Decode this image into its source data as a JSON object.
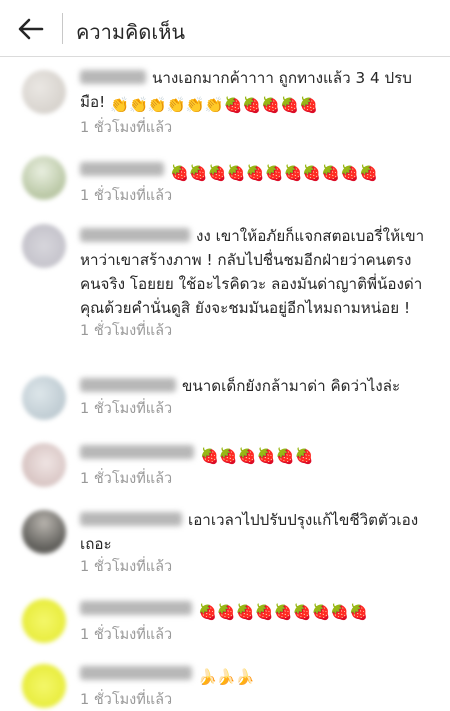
{
  "header": {
    "title": "ความคิดเห็น"
  },
  "comments": [
    {
      "username": "areej_ahn",
      "text_before": "นางเอกมากค้าาาา ถูกทางแล้ว 3 4 ปรบมือ!",
      "emojis": "👏👏👏👏👏👏🍓🍓🍓🍓🍓",
      "time": "1 ชั่วโมงที่แล้ว"
    },
    {
      "username": "tabooo_cnppa",
      "text_before": "",
      "emojis": "🍓🍓🍓🍓🍓🍓🍓🍓🍓🍓🍓",
      "time": "1 ชั่วโมงที่แล้ว"
    },
    {
      "username": "patnnnakchu35",
      "text_before": "งง เขาให้อภัยก็แจกสตอเบอรี่ให้เขาหาว่าเขาสร้างภาพ ! กลับไปชื่นชมอีกฝ่ายว่าคนตรงคนจริง โอยยย ใช้อะไรคิดวะ ลองมันด่าญาติพี่น้องด่าคุณด้วยคำนั่นดูสิ ยังจะชมมันอยู่อีกไหมถามหน่อย !",
      "emojis": "",
      "time": "1 ชั่วโมงที่แล้ว"
    },
    {
      "username": "jmew_hanoke",
      "text_before": "ขนาดเด็กยังกล้ามาด่า คิดว่าไงล่ะ",
      "emojis": "",
      "time": "1 ชั่วโมงที่แล้ว"
    },
    {
      "username": "pikkmikoumacob",
      "text_before": "",
      "emojis": "🍓🍓🍓🍓🍓🍓",
      "time": "1 ชั่วโมงที่แล้ว"
    },
    {
      "username": "patanpee_679",
      "text_before": "เอาเวลาไปปรับปรุงแก้ไขชีวิตตัวเองเถอะ",
      "emojis": "",
      "time": "1 ชั่วโมงที่แล้ว"
    },
    {
      "username": "ffye_irdawuffkkk",
      "text_before": "",
      "emojis": "🍓🍓🍓🍓🍓🍓🍓🍓🍓",
      "time": "1 ชั่วโมงที่แล้ว"
    },
    {
      "username": "ffye_irdawuffkkk",
      "text_before": "",
      "emojis": "🍌🍌🍌",
      "time": "1 ชั่วโมงที่แล้ว"
    }
  ],
  "colors": {
    "text": "#262626",
    "time": "#999999",
    "divider": "#dbdbdb",
    "avatar_1": "#d6d2cd",
    "avatar_2": "#c9d4b8",
    "avatar_3": "#c9c7cf",
    "avatar_4": "#bcc8cf",
    "avatar_5": "#d8c7c6",
    "avatar_6": "#6e6e6a",
    "avatar_7": "#eef23a",
    "avatar_8": "#eef23a"
  }
}
